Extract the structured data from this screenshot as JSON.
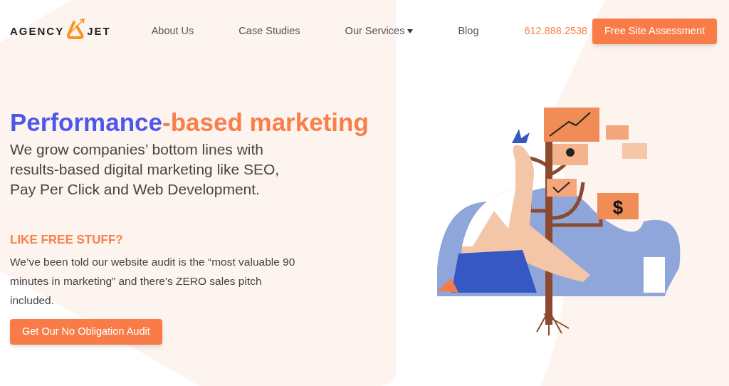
{
  "logo": {
    "left": "AGENCY",
    "right": "JET"
  },
  "nav": [
    {
      "label": "About Us",
      "has_menu": false
    },
    {
      "label": "Case Studies",
      "has_menu": false
    },
    {
      "label": "Our Services",
      "has_menu": true
    },
    {
      "label": "Blog",
      "has_menu": false
    }
  ],
  "phone": "612.888.2538",
  "cta": "Free Site Assessment",
  "hero": {
    "heading": [
      {
        "text": "Performance",
        "color": "#4c57ec"
      },
      {
        "text": "-based marketing",
        "color": "#f7804a"
      }
    ],
    "subtitle": "We grow companies’ bottom lines with results-based digital marketing like SEO, Pay Per Click and Web Development.",
    "offer_title": "LIKE FREE STUFF?",
    "offer_text": "We’ve been told our website audit is the “most valuable 90 minutes in marketing” and there's ZERO sales pitch included.",
    "button": "Get Our No Obligation Audit"
  },
  "illustration": {
    "sign": "$"
  }
}
